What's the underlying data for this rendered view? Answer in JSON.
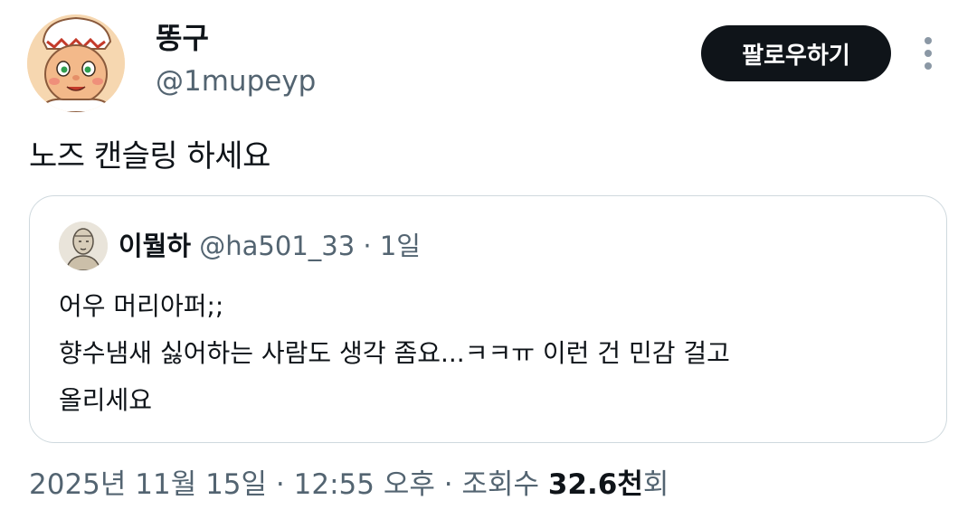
{
  "author": {
    "display_name": "똥구",
    "handle": "@1mupeyp",
    "avatar_icon": "cartoon-chef-avatar"
  },
  "follow_button": {
    "label": "팔로우하기"
  },
  "more_icon": "more-vertical-icon",
  "tweet": {
    "text": "노즈 캔슬링 하세요"
  },
  "quote": {
    "display_name": "이뭘하",
    "handle": "@ha501_33",
    "separator": " · ",
    "time": "1일",
    "avatar_icon": "sketch-portrait-avatar",
    "lines": [
      "어우 머리아퍼;;",
      "향수냄새 싫어하는 사람도 생각 좀요...ㅋㅋㅠ 이런 건 민감 걸고",
      "올리세요"
    ]
  },
  "meta": {
    "date": "2025년 11월 15일",
    "separator": " · ",
    "time": "12:55 오후",
    "views_label_prefix": "조회수 ",
    "views_count": "32.6천",
    "views_suffix": "회"
  },
  "colors": {
    "text_primary": "#0f1419",
    "text_secondary": "#536471",
    "border": "#cfd9de",
    "button_bg": "#0f1419",
    "button_text": "#ffffff"
  }
}
